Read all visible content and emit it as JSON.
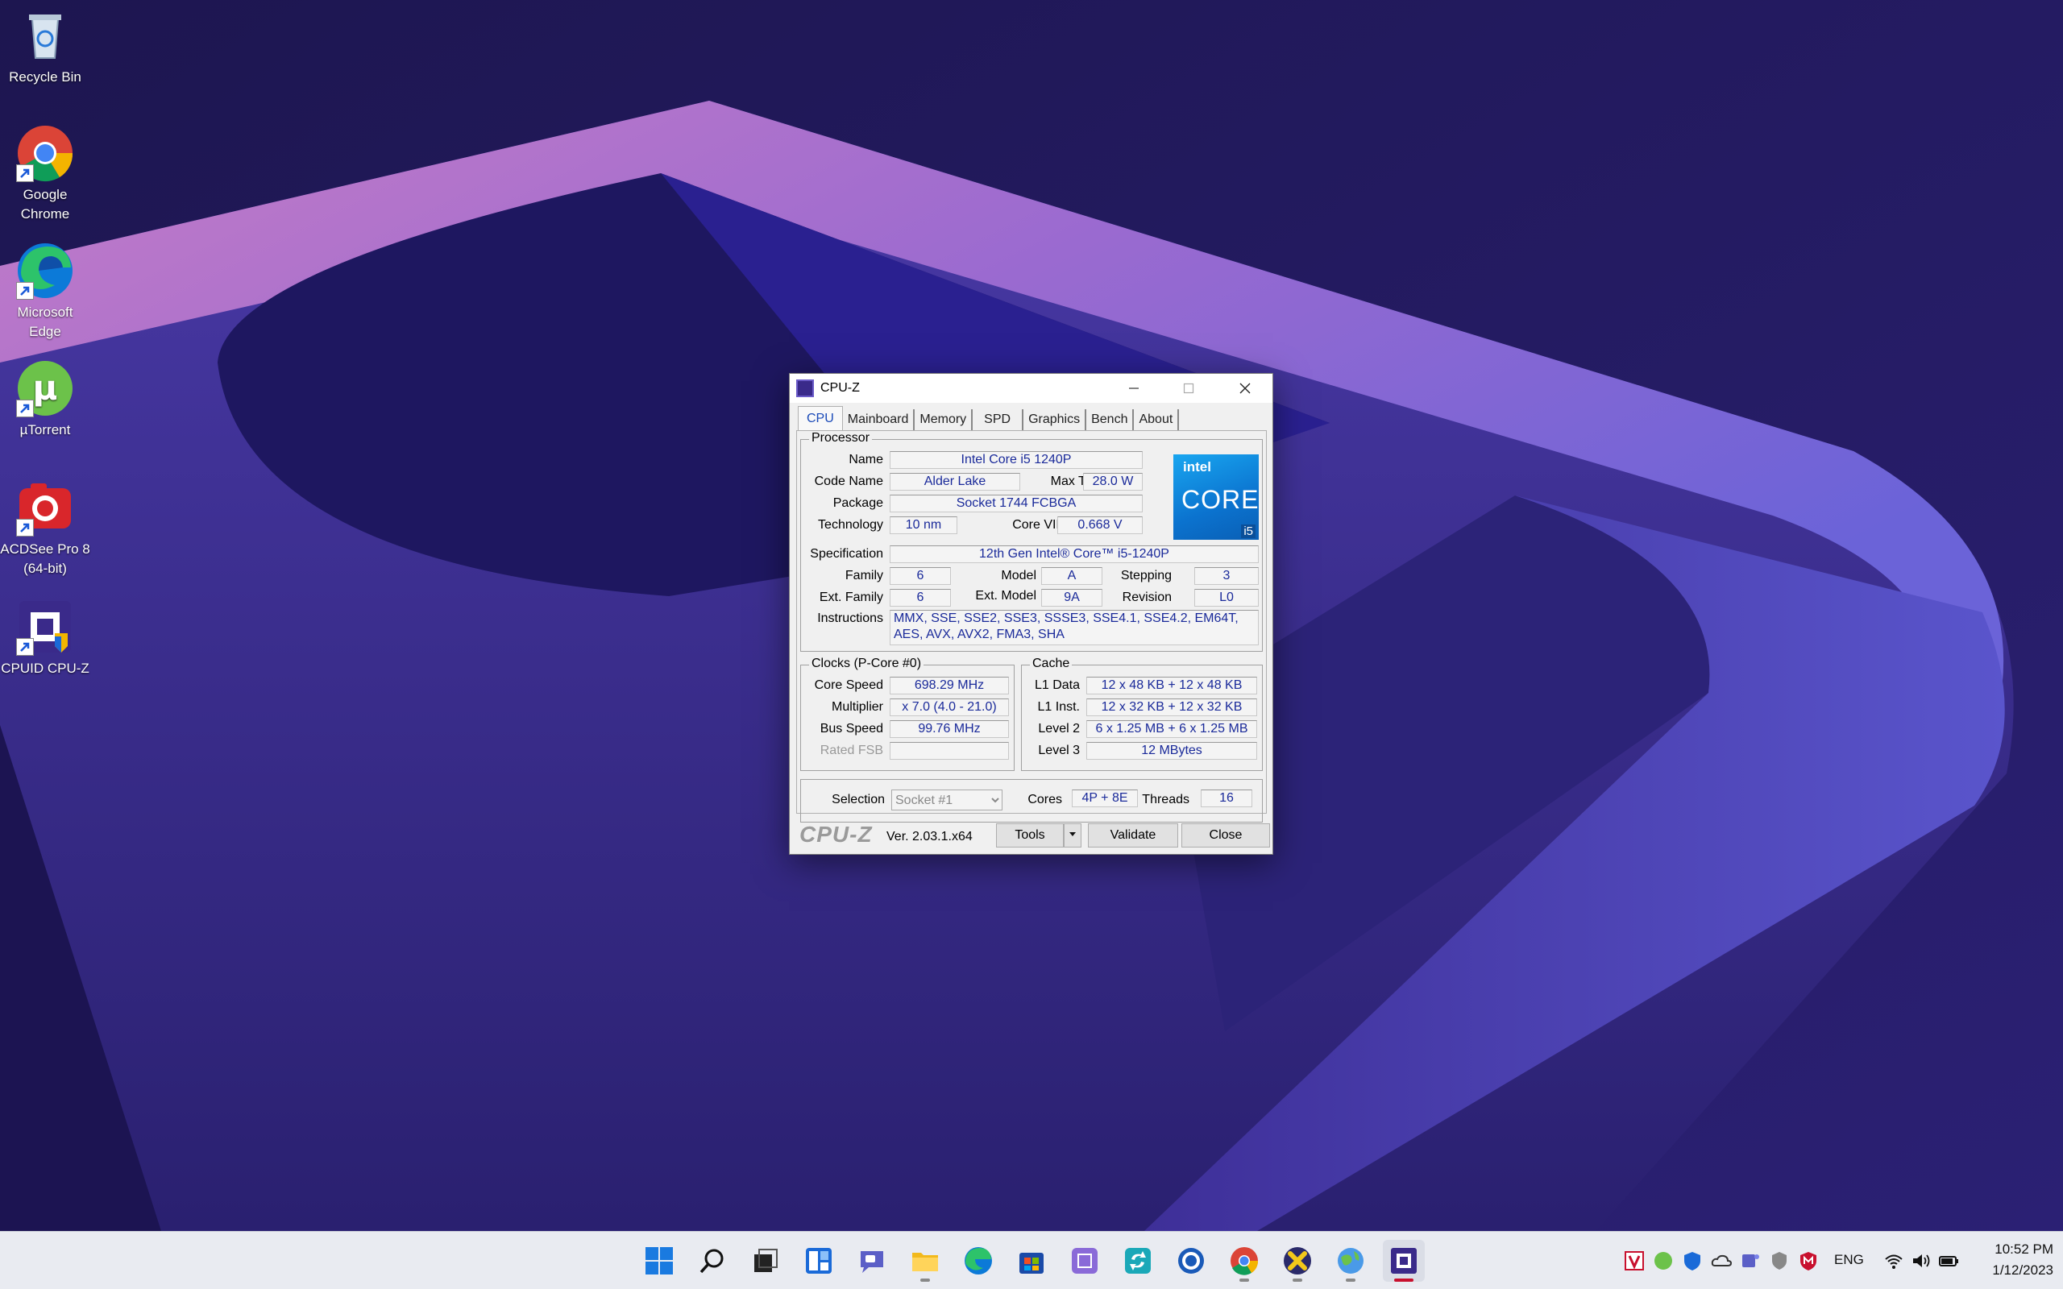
{
  "desktop": {
    "icons": [
      {
        "label": "Recycle Bin"
      },
      {
        "label": "Google Chrome"
      },
      {
        "label": "Microsoft Edge"
      },
      {
        "label": "µTorrent"
      },
      {
        "label": "ACDSee Pro 8 (64-bit)"
      },
      {
        "label": "CPUID CPU-Z"
      }
    ]
  },
  "window": {
    "title": "CPU-Z",
    "tabs": [
      "CPU",
      "Mainboard",
      "Memory",
      "SPD",
      "Graphics",
      "Bench",
      "About"
    ],
    "active_tab": "CPU",
    "processor": {
      "group_title": "Processor",
      "name_label": "Name",
      "name": "Intel Core i5 1240P",
      "codename_label": "Code Name",
      "codename": "Alder Lake",
      "maxtdp_label": "Max TDP",
      "maxtdp": "28.0 W",
      "package_label": "Package",
      "package": "Socket 1744 FCBGA",
      "technology_label": "Technology",
      "technology": "10 nm",
      "corevid_label": "Core VID",
      "corevid": "0.668 V",
      "spec_label": "Specification",
      "spec": "12th Gen Intel® Core™ i5-1240P",
      "family_label": "Family",
      "family": "6",
      "model_label": "Model",
      "model": "A",
      "stepping_label": "Stepping",
      "stepping": "3",
      "extfamily_label": "Ext. Family",
      "extfamily": "6",
      "extmodel_label": "Ext. Model",
      "extmodel": "9A",
      "revision_label": "Revision",
      "revision": "L0",
      "instructions_label": "Instructions",
      "instructions": "MMX, SSE, SSE2, SSE3, SSSE3, SSE4.1, SSE4.2, EM64T, AES, AVX, AVX2, FMA3, SHA",
      "logo": {
        "brand": "intel",
        "line": "CORE",
        "tier": "i5"
      }
    },
    "clocks": {
      "group_title": "Clocks (P-Core #0)",
      "corespeed_label": "Core Speed",
      "corespeed": "698.29 MHz",
      "multiplier_label": "Multiplier",
      "multiplier": "x 7.0 (4.0 - 21.0)",
      "busspeed_label": "Bus Speed",
      "busspeed": "99.76 MHz",
      "ratedfsb_label": "Rated FSB",
      "ratedfsb": ""
    },
    "cache": {
      "group_title": "Cache",
      "l1data_label": "L1 Data",
      "l1data": "12 x 48 KB + 12 x 48 KB",
      "l1inst_label": "L1 Inst.",
      "l1inst": "12 x 32 KB + 12 x 32 KB",
      "level2_label": "Level 2",
      "level2": "6 x 1.25 MB + 6 x 1.25 MB",
      "level3_label": "Level 3",
      "level3": "12 MBytes"
    },
    "selection": {
      "label": "Selection",
      "value": "Socket #1",
      "cores_label": "Cores",
      "cores": "4P + 8E",
      "threads_label": "Threads",
      "threads": "16"
    },
    "footer": {
      "brand": "CPU-Z",
      "version": "Ver. 2.03.1.x64",
      "tools_label": "Tools",
      "validate_label": "Validate",
      "close_label": "Close"
    }
  },
  "taskbar": {
    "apps": [
      "start",
      "search",
      "task-view",
      "widgets",
      "chat",
      "file-explorer",
      "edge",
      "store",
      "app-purple",
      "app-sync",
      "app-circle",
      "chrome",
      "app-x",
      "app-globe",
      "cpu-z"
    ],
    "tray": {
      "language": "ENG",
      "time": "10:52 PM",
      "date": "1/12/2023"
    }
  }
}
